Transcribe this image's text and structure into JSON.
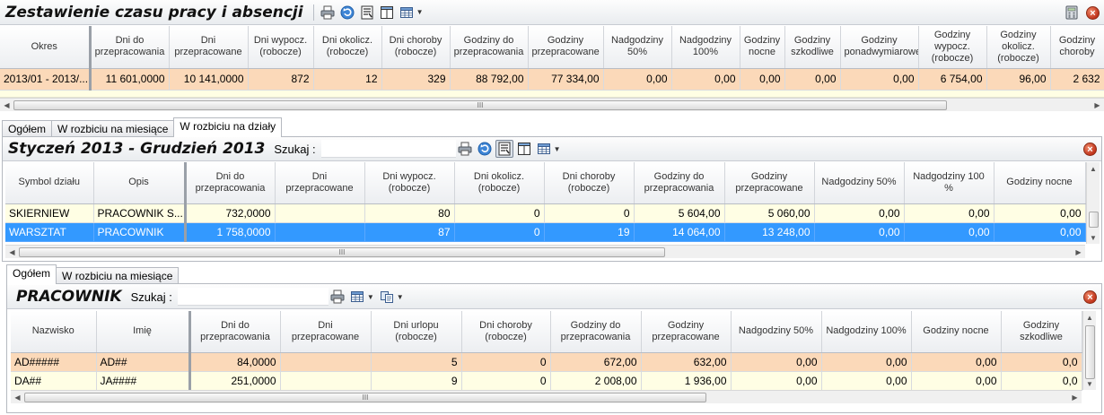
{
  "window": {
    "title": "Zestawienie czasu pracy i absencji"
  },
  "top_grid": {
    "columns": [
      "Okres",
      "Dni do przepracowania",
      "Dni przepracowane",
      "Dni wypocz. (robocze)",
      "Dni okolicz. (robocze)",
      "Dni choroby (robocze)",
      "Godziny do przepracowania",
      "Godziny przepracowane",
      "Nadgodziny 50%",
      "Nadgodziny 100%",
      "Godziny nocne",
      "Godziny szkodliwe",
      "Godziny ponadwymiarowe",
      "Godziny wypocz. (robocze)",
      "Godziny okolicz. (robocze)",
      "Godziny choroby"
    ],
    "rows": [
      [
        "2013/01 - 2013/...",
        "11 601,0000",
        "10 141,0000",
        "872",
        "12",
        "329",
        "88 792,00",
        "77 334,00",
        "0,00",
        "0,00",
        "0,00",
        "0,00",
        "0,00",
        "6 754,00",
        "96,00",
        "2 632"
      ]
    ]
  },
  "tabs_top": [
    "Ogółem",
    "W rozbiciu na miesiące",
    "W rozbiciu na działy"
  ],
  "tabs_top_active": 2,
  "dept_panel": {
    "title": "Styczeń 2013 - Grudzień 2013",
    "search_label": "Szukaj  :",
    "search_value": "",
    "columns": [
      "Symbol działu",
      "Opis",
      "Dni do przepracowania",
      "Dni przepracowane",
      "Dni wypocz. (robocze)",
      "Dni okolicz. (robocze)",
      "Dni choroby (robocze)",
      "Godziny do przepracowania",
      "Godziny przepracowane",
      "Nadgodziny 50%",
      "Nadgodziny 100 %",
      "Godziny nocne"
    ],
    "rows": [
      [
        "SKIERNIEW",
        "PRACOWNIK S...",
        "732,0000",
        "",
        "80",
        "0",
        "0",
        "5 604,00",
        "5 060,00",
        "0,00",
        "0,00",
        "0,00"
      ],
      [
        "WARSZTAT",
        "PRACOWNIK",
        "1 758,0000",
        "",
        "87",
        "0",
        "19",
        "14 064,00",
        "13 248,00",
        "0,00",
        "0,00",
        "0,00"
      ]
    ]
  },
  "tabs_bottom": [
    "Ogółem",
    "W rozbiciu na miesiące"
  ],
  "tabs_bottom_active": 0,
  "emp_panel": {
    "title": "PRACOWNIK",
    "search_label": "Szukaj  :",
    "search_value": "",
    "columns": [
      "Nazwisko",
      "Imię",
      "Dni do przepracowania",
      "Dni przepracowane",
      "Dni urlopu (robocze)",
      "Dni choroby (robocze)",
      "Godziny do przepracowania",
      "Godziny przepracowane",
      "Nadgodziny 50%",
      "Nadgodziny 100%",
      "Godziny nocne",
      "Godziny szkodliwe"
    ],
    "rows": [
      [
        "AD#####",
        "AD##",
        "84,0000",
        "",
        "5",
        "0",
        "672,00",
        "632,00",
        "0,00",
        "0,00",
        "0,00",
        "0,0"
      ],
      [
        "DA##",
        "JA####",
        "251,0000",
        "",
        "9",
        "0",
        "2 008,00",
        "1 936,00",
        "0,00",
        "0,00",
        "0,00",
        "0,0"
      ]
    ]
  },
  "scroll_grip": "III",
  "icons": {
    "print": "print-icon",
    "refresh": "refresh-icon",
    "filter": "filter-icon",
    "columns": "columns-icon",
    "grid": "grid-icon",
    "copy": "copy-icon",
    "calculator": "calculator-icon",
    "close": "close-icon"
  }
}
